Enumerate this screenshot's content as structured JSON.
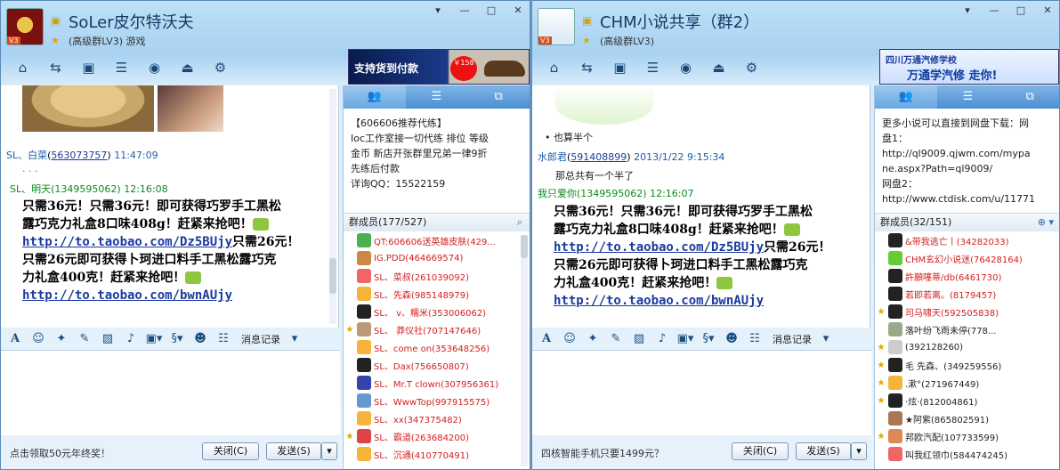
{
  "left": {
    "title": "SoLer皮尔特沃夫",
    "subtitle": "(高级群LV3) 游戏",
    "avatar_badge": "V3",
    "ad_text": "支持货到付款",
    "ad_price": "￥158",
    "messages": [
      {
        "name": "SL、白菜",
        "id": "563073757",
        "time": "11:47:09"
      },
      {
        "name": "SL、明天",
        "id": "1349595062",
        "time": "12:16:08"
      }
    ],
    "dots": "· · ·",
    "promo_line1": "只需36元！只需36元！即可获得巧罗手工黑松",
    "promo_line2": "露巧克力礼盒8口味408g！赶紧来抢吧！",
    "promo_link1": "http://to.taobao.com/Dz5BUjy",
    "promo_line3": "只需26元！",
    "promo_line4": "只需26元即可获得卜珂进口料手工黑松露巧克",
    "promo_line5": "力礼盒400克！赶紧来抢吧！",
    "promo_link2": "http://to.taobao.com/bwnAUjy",
    "record_label": "消息记录",
    "footer_tip": "点击领取50元年终奖！",
    "close_label": "关闭(C)",
    "send_label": "发送(S)",
    "notice": [
      "【606606推荐代练】",
      "Ioc工作室接一切代练 排位 等级",
      "金币 新店开张群里兄弟一律9折",
      "先练后付款",
      "详询QQ：15522159"
    ],
    "members_header": "群成员(177/527)",
    "members": [
      {
        "name": "QT:606606送英雄皮肤(429...",
        "color": "red"
      },
      {
        "name": "IG.PDD(464669574)",
        "color": "red"
      },
      {
        "name": "SL、菜叔(261039092)",
        "color": "red"
      },
      {
        "name": "SL、先森(985148979)",
        "color": "red"
      },
      {
        "name": "SL、 v、糯米(353006062)",
        "color": "red"
      },
      {
        "name": "SL、 莽仪社(707147646)",
        "color": "red"
      },
      {
        "name": "SL、come on(353648256)",
        "color": "red"
      },
      {
        "name": "SL、Dax(756650807)",
        "color": "red"
      },
      {
        "name": "SL、Mr.T clown(307956361)",
        "color": "red"
      },
      {
        "name": "SL、WwwTop(997915575)",
        "color": "red"
      },
      {
        "name": "SL、xx(347375482)",
        "color": "red"
      },
      {
        "name": "SL、霸道(263684200)",
        "color": "red"
      },
      {
        "name": "SL、沉通(410770491)",
        "color": "red"
      }
    ]
  },
  "right": {
    "title": "CHM小说共享（群2）",
    "subtitle": "(高级群LV3)",
    "avatar_badge": "V3",
    "ad_text": "四川万通汽修学校",
    "ad_text2": "万通学汽修 走你!",
    "pre_line": "• 也算半个",
    "messages": [
      {
        "name": "水郎君",
        "id": "591408899",
        "time": "2013/1/22 9:15:34"
      },
      {
        "name": "我只爱你",
        "id": "1349595062",
        "time": "12:16:07"
      }
    ],
    "reply": "那总共有一个半了",
    "promo_line1": "只需36元！只需36元！即可获得巧罗手工黑松",
    "promo_line2": "露巧克力礼盒8口味408g！赶紧来抢吧！",
    "promo_link1": "http://to.taobao.com/Dz5BUjy",
    "promo_line3": "只需26元！",
    "promo_line4": "只需26元即可获得卜珂进口料手工黑松露巧克",
    "promo_line5": "力礼盒400克！赶紧来抢吧！",
    "promo_link2": "http://to.taobao.com/bwnAUjy",
    "record_label": "消息记录",
    "footer_tip": "四核智能手机只要1499元？",
    "close_label": "关闭(C)",
    "send_label": "发送(S)",
    "notice": [
      "更多小说可以直接到网盘下载：网",
      "盘1：",
      "http://ql9009.qjwm.com/mypa",
      "ne.aspx?Path=ql9009/",
      "网盘2：",
      "http://www.ctdisk.com/u/11771"
    ],
    "members_header": "群成员(32/151)",
    "members": [
      {
        "name": "&带我逃亡丨(34282033)",
        "color": "red"
      },
      {
        "name": "CHM玄幻小说迷(76428164)",
        "color": "red"
      },
      {
        "name": "許願噻蒂/db(6461730)",
        "color": "red"
      },
      {
        "name": "若即若离。(8179457)",
        "color": "red"
      },
      {
        "name": "司马啸天(592505838)",
        "color": "red"
      },
      {
        "name": "落叶纷飞雨未停(778...",
        "color": "black"
      },
      {
        "name": "(392128260)",
        "color": "black"
      },
      {
        "name": "毛 先森、(349259556)",
        "color": "black"
      },
      {
        "name": ".漱°(271967449)",
        "color": "black"
      },
      {
        "name": "·炫·(812004861)",
        "color": "black"
      },
      {
        "name": "★阿紫(865802591)",
        "color": "black"
      },
      {
        "name": "邦欧汽配(107733599)",
        "color": "black"
      },
      {
        "name": "叫我红领巾(584474245)",
        "color": "black"
      }
    ]
  }
}
